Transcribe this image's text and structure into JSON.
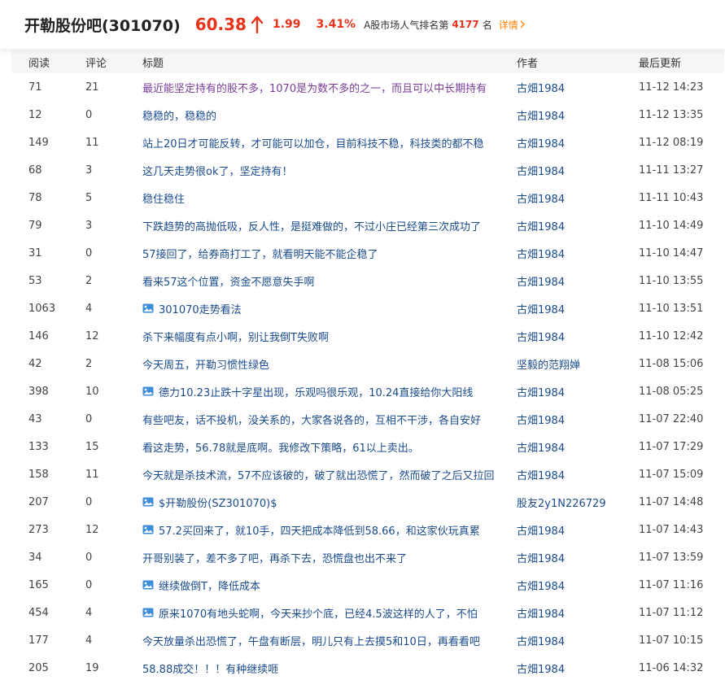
{
  "header": {
    "title": "开勒股份吧(301070)",
    "price": "60.38",
    "change": "1.99",
    "pct": "3.41%",
    "rank_prefix": "A股市场人气排名第",
    "rank_num": "4177",
    "rank_suffix": "名",
    "detail": "详情",
    "up_color": "#e8331b"
  },
  "columns": {
    "read": "阅读",
    "comment": "评论",
    "title": "标题",
    "author": "作者",
    "updated": "最后更新"
  },
  "rows": [
    {
      "read": "71",
      "comments": "21",
      "title": "最近能坚定持有的股不多，1070是为数不多的之一，而且可以中长期持有",
      "author": "古畑1984",
      "time": "11-12 14:23",
      "visited": true,
      "pic": false
    },
    {
      "read": "12",
      "comments": "0",
      "title": "稳稳的，稳稳的",
      "author": "古畑1984",
      "time": "11-12 13:35",
      "visited": false,
      "pic": false
    },
    {
      "read": "149",
      "comments": "11",
      "title": "站上20日才可能反转，才可能可以加仓，目前科技不稳，科技类的都不稳",
      "author": "古畑1984",
      "time": "11-12 08:19",
      "visited": false,
      "pic": false
    },
    {
      "read": "68",
      "comments": "3",
      "title": "这几天走势很ok了，坚定持有！",
      "author": "古畑1984",
      "time": "11-11 13:27",
      "visited": false,
      "pic": false
    },
    {
      "read": "78",
      "comments": "5",
      "title": "稳住稳住",
      "author": "古畑1984",
      "time": "11-11 10:43",
      "visited": false,
      "pic": false
    },
    {
      "read": "79",
      "comments": "3",
      "title": "下跌趋势的高抛低吸，反人性，是挺难做的，不过小庄已经第三次成功了",
      "author": "古畑1984",
      "time": "11-10 14:49",
      "visited": false,
      "pic": false
    },
    {
      "read": "31",
      "comments": "0",
      "title": "57接回了，给券商打工了，就看明天能不能企稳了",
      "author": "古畑1984",
      "time": "11-10 14:47",
      "visited": false,
      "pic": false
    },
    {
      "read": "53",
      "comments": "2",
      "title": "看来57这个位置，资金不愿意失手啊",
      "author": "古畑1984",
      "time": "11-10 13:55",
      "visited": false,
      "pic": false
    },
    {
      "read": "1063",
      "comments": "4",
      "title": "301070走势看法",
      "author": "古畑1984",
      "time": "11-10 13:51",
      "visited": false,
      "pic": true
    },
    {
      "read": "146",
      "comments": "12",
      "title": "杀下来幅度有点小啊，别让我倒T失败啊",
      "author": "古畑1984",
      "time": "11-10 12:42",
      "visited": false,
      "pic": false
    },
    {
      "read": "42",
      "comments": "2",
      "title": "今天周五，开勒习惯性绿色",
      "author": "坚毅的范翔婵",
      "time": "11-08 15:06",
      "visited": false,
      "pic": false
    },
    {
      "read": "398",
      "comments": "10",
      "title": "德力10.23止跌十字星出现，乐观吗很乐观，10.24直接给你大阳线",
      "author": "古畑1984",
      "time": "11-08 05:25",
      "visited": false,
      "pic": true
    },
    {
      "read": "43",
      "comments": "0",
      "title": "有些吧友，话不投机，没关系的，大家各说各的，互相不干涉，各自安好",
      "author": "古畑1984",
      "time": "11-07 22:40",
      "visited": false,
      "pic": false
    },
    {
      "read": "133",
      "comments": "15",
      "title": "看这走势，56.78就是底啊。我修改下策略，61以上卖出。",
      "author": "古畑1984",
      "time": "11-07 17:29",
      "visited": false,
      "pic": false
    },
    {
      "read": "158",
      "comments": "11",
      "title": "今天就是杀技术流，57不应该破的，破了就出恐慌了，然而破了之后又拉回",
      "author": "古畑1984",
      "time": "11-07 15:09",
      "visited": false,
      "pic": false
    },
    {
      "read": "207",
      "comments": "0",
      "title": "$开勒股份(SZ301070)$",
      "author": "股友2y1N226729",
      "time": "11-07 14:48",
      "visited": false,
      "pic": true
    },
    {
      "read": "273",
      "comments": "12",
      "title": "57.2买回来了，就10手，四天把成本降低到58.66，和这家伙玩真累",
      "author": "古畑1984",
      "time": "11-07 14:43",
      "visited": false,
      "pic": true
    },
    {
      "read": "34",
      "comments": "0",
      "title": "开哥别装了，差不多了吧，再杀下去，恐慌盘也出不来了",
      "author": "古畑1984",
      "time": "11-07 13:59",
      "visited": false,
      "pic": false
    },
    {
      "read": "165",
      "comments": "0",
      "title": "继续做倒T，降低成本",
      "author": "古畑1984",
      "time": "11-07 11:16",
      "visited": false,
      "pic": true
    },
    {
      "read": "454",
      "comments": "4",
      "title": "原来1070有地头蛇啊，今天来抄个底，已经4.5波这样的人了，不怕",
      "author": "古畑1984",
      "time": "11-07 11:12",
      "visited": false,
      "pic": true
    },
    {
      "read": "177",
      "comments": "4",
      "title": "今天放量杀出恐慌了，午盘有断层，明儿只有上去摸5和10日，再看看吧",
      "author": "古畑1984",
      "time": "11-07 10:15",
      "visited": false,
      "pic": false
    },
    {
      "read": "205",
      "comments": "19",
      "title": "58.88成交！！！有种继续咂",
      "author": "古畑1984",
      "time": "11-06 14:32",
      "visited": false,
      "pic": false
    }
  ]
}
